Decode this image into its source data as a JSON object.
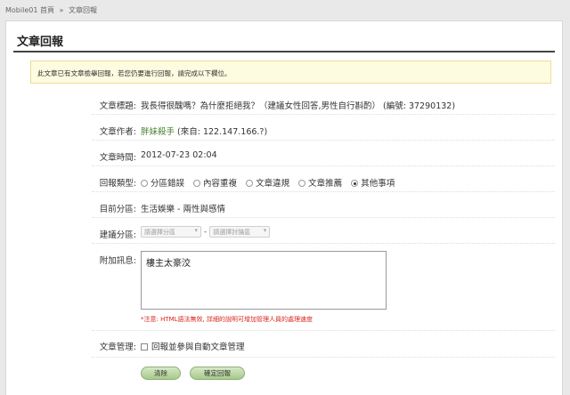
{
  "breadcrumb": {
    "home": "Mobile01 首頁",
    "separator": "»",
    "current": "文章回報"
  },
  "panel": {
    "title": "文章回報"
  },
  "notice": "此文章已有文章檢舉回報，若您仍要進行回報，請完成以下欄位。",
  "fields": {
    "title": {
      "label": "文章標題:",
      "value": "我長得很醜嗎？為什麼拒絕我？（建議女性回答,男性自行斟酌） (編號: 37290132)"
    },
    "author": {
      "label": "文章作者:",
      "name": "胖妹殺手",
      "ip": "(來自: 122.147.166.?)"
    },
    "time": {
      "label": "文章時間:",
      "value": "2012-07-23 02:04"
    },
    "type": {
      "label": "回報類型:",
      "options": [
        "分區錯誤",
        "內容重複",
        "文章違規",
        "文章推薦",
        "其他事項"
      ],
      "selected": "其他事項"
    },
    "current": {
      "label": "目前分區:",
      "value": "生活娛樂 - 兩性與感情"
    },
    "suggest": {
      "label": "建議分區:",
      "select1": "請選擇分區",
      "dash": "-",
      "select2": "請選擇討論區"
    },
    "note": {
      "label": "附加訊息:",
      "value": "樓主太豪洨",
      "warning": "*注意: HTML語法無效, 詳細的說明可增加管理人員的處理速度"
    },
    "manage": {
      "label": "文章管理:",
      "checkbox_label": "回報並參與自動文章管理"
    }
  },
  "buttons": {
    "clear": "清除",
    "submit": "確定回報"
  },
  "colors": {
    "link": "#4a7f2d",
    "warning": "#d9261c",
    "notice_bg": "#fdfbe0",
    "button": "#a6c98a"
  }
}
